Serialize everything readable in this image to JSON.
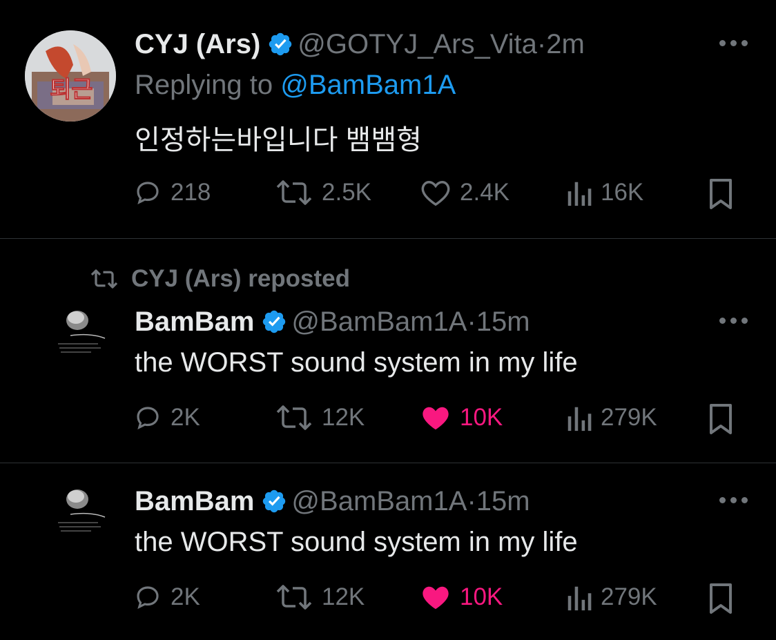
{
  "tweets": [
    {
      "name": "CYJ (Ars)",
      "handle": "@GOTYJ_Ars_Vita",
      "sep": "·",
      "time": "2m",
      "replying_prefix": "Replying to ",
      "replying_to": "@BamBam1A",
      "avatar_text": "퇴근",
      "text": "인정하는바입니다 뱀뱀형",
      "replies": "218",
      "reposts": "2.5K",
      "likes": "2.4K",
      "views": "16K",
      "liked": false
    },
    {
      "repost_label": "CYJ (Ars) reposted",
      "name": "BamBam",
      "handle": "@BamBam1A",
      "sep": "·",
      "time": "15m",
      "text": "the WORST sound system in my life",
      "replies": "2K",
      "reposts": "12K",
      "likes": "10K",
      "views": "279K",
      "liked": true
    },
    {
      "name": "BamBam",
      "handle": "@BamBam1A",
      "sep": "·",
      "time": "15m",
      "text": "the WORST sound system in my life",
      "replies": "2K",
      "reposts": "12K",
      "likes": "10K",
      "views": "279K",
      "liked": true
    }
  ],
  "colors": {
    "background": "#000000",
    "text": "#e7e9ea",
    "muted": "#71767b",
    "link": "#1d9bf0",
    "like": "#f91880",
    "divider": "#2f3336"
  },
  "icons": [
    "verified-icon",
    "more-icon",
    "reply-icon",
    "repost-icon",
    "like-icon",
    "views-icon",
    "bookmark-icon"
  ]
}
